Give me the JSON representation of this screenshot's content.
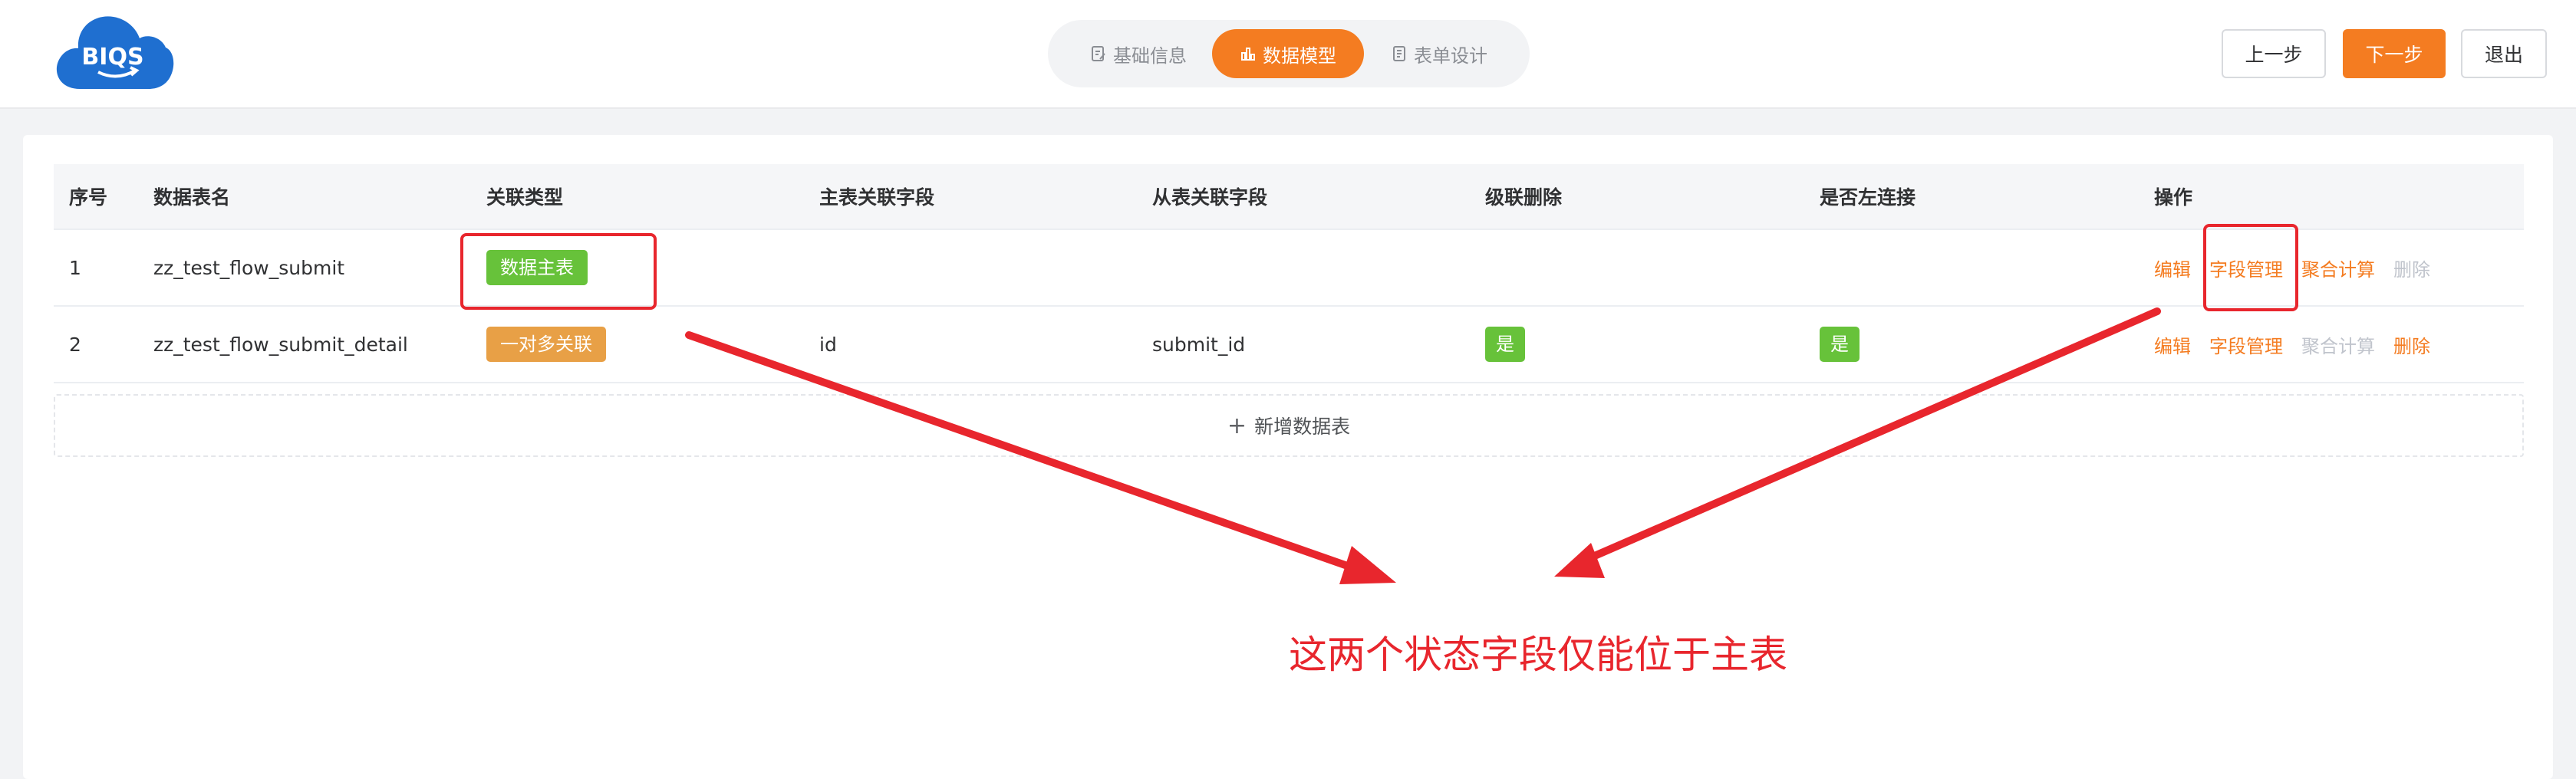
{
  "header": {
    "logo_text": "BIQS",
    "steps": [
      {
        "label": "基础信息",
        "icon": "document-edit-icon",
        "active": false
      },
      {
        "label": "数据模型",
        "icon": "bar-chart-icon",
        "active": true
      },
      {
        "label": "表单设计",
        "icon": "form-icon",
        "active": false
      }
    ],
    "prev_label": "上一步",
    "next_label": "下一步",
    "exit_label": "退出"
  },
  "table": {
    "columns": [
      "序号",
      "数据表名",
      "关联类型",
      "主表关联字段",
      "从表关联字段",
      "级联删除",
      "是否左连接",
      "操作"
    ],
    "rows": [
      {
        "index": "1",
        "name": "zz_test_flow_submit",
        "relation": "数据主表",
        "relation_color": "#67c23a",
        "main_field": "",
        "sub_field": "",
        "cascade_delete": "",
        "left_join": "",
        "ops": {
          "edit": "编辑",
          "fields": "字段管理",
          "aggregate": "聚合计算",
          "delete": "删除"
        },
        "ops_state": {
          "aggregate_enabled": true,
          "delete_enabled": false
        }
      },
      {
        "index": "2",
        "name": "zz_test_flow_submit_detail",
        "relation": "一对多关联",
        "relation_color": "#e8a046",
        "main_field": "id",
        "sub_field": "submit_id",
        "cascade_delete": "是",
        "left_join": "是",
        "ops": {
          "edit": "编辑",
          "fields": "字段管理",
          "aggregate": "聚合计算",
          "delete": "删除"
        },
        "ops_state": {
          "aggregate_enabled": false,
          "delete_enabled": true
        }
      }
    ],
    "add_label": "新增数据表"
  },
  "annotation": {
    "text": "这两个状态字段仅能位于主表",
    "color": "#e8262d"
  },
  "colors": {
    "accent": "#f47c21",
    "success": "#67c23a",
    "warning": "#e8a046",
    "logo_blue": "#1f6fd0"
  }
}
